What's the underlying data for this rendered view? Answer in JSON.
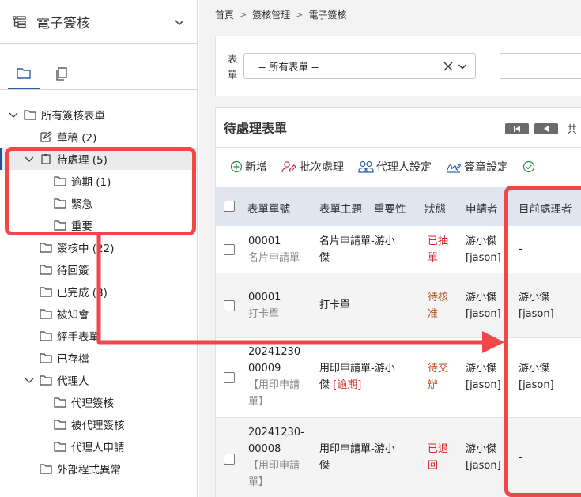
{
  "sidebar": {
    "title": "電子簽核",
    "tree": {
      "root": "所有簽核表單",
      "draft": "草稿 (2)",
      "pending": "待處理 (5)",
      "overdue": "逾期 (1)",
      "urgent": "緊急",
      "important": "重要",
      "signing": "簽核中 (22)",
      "waiting_return": "待回簽",
      "completed": "已完成 (8)",
      "notified": "被知會",
      "handled": "經手表單",
      "archived": "已存檔",
      "proxy": "代理人",
      "proxy_sign": "代理簽核",
      "proxied_sign": "被代理簽核",
      "proxy_apply": "代理人申請",
      "external_error": "外部程式異常"
    }
  },
  "breadcrumb": {
    "home": "首頁",
    "mgmt": "簽核管理",
    "current": "電子簽核"
  },
  "filter": {
    "label": "表單",
    "form_select_value": "-- 所有表單 --"
  },
  "panel": {
    "title": "待處理表單",
    "total_prefix": "共",
    "toolbar": {
      "add": "新增",
      "batch": "批次處理",
      "proxy_setting": "代理人設定",
      "signature_setting": "簽章設定"
    },
    "columns": {
      "form_no": "表單單號",
      "subject": "表單主題",
      "importance": "重要性",
      "status": "狀態",
      "applicant": "申請者",
      "current_handler": "目前處理者"
    },
    "rows": [
      {
        "no_a": "00001",
        "no_b": "",
        "type": "名片申請單",
        "subject_a": "名片申請單-游小",
        "subject_b": "傑",
        "tag": "",
        "status_a": "已抽",
        "status_b": "單",
        "applicant_a": "游小傑",
        "applicant_b": "[jason]",
        "handler_a": "-",
        "handler_b": ""
      },
      {
        "no_a": "00001",
        "no_b": "",
        "type": "打卡單",
        "subject_a": "打卡單",
        "subject_b": "",
        "tag": "",
        "status_a": "待核",
        "status_b": "准",
        "applicant_a": "游小傑",
        "applicant_b": "[jason]",
        "handler_a": "游小傑",
        "handler_b": "[jason]"
      },
      {
        "no_a": "20241230-",
        "no_b": "00009",
        "type_a": "【用印申請",
        "type_b": "單】",
        "subject_a": "用印申請單-游小",
        "subject_b": "傑",
        "tag": "[逾期]",
        "status_a": "待交",
        "status_b": "辦",
        "applicant_a": "游小傑",
        "applicant_b": "[jason]",
        "handler_a": "游小傑",
        "handler_b": "[jason]"
      },
      {
        "no_a": "20241230-",
        "no_b": "00008",
        "type_a": "【用印申請",
        "type_b": "單】",
        "subject_a": "用印申請單-游小",
        "subject_b": "傑",
        "tag": "",
        "status_a": "已退",
        "status_b": "回",
        "applicant_a": "游小傑",
        "applicant_b": "[jason]",
        "handler_a": "-",
        "handler_b": ""
      }
    ]
  },
  "colors": {
    "accent": "#2d5ea8",
    "annotation": "#f0474a",
    "status_red": "#d42a2a",
    "header_bg": "#dfe6f0"
  }
}
